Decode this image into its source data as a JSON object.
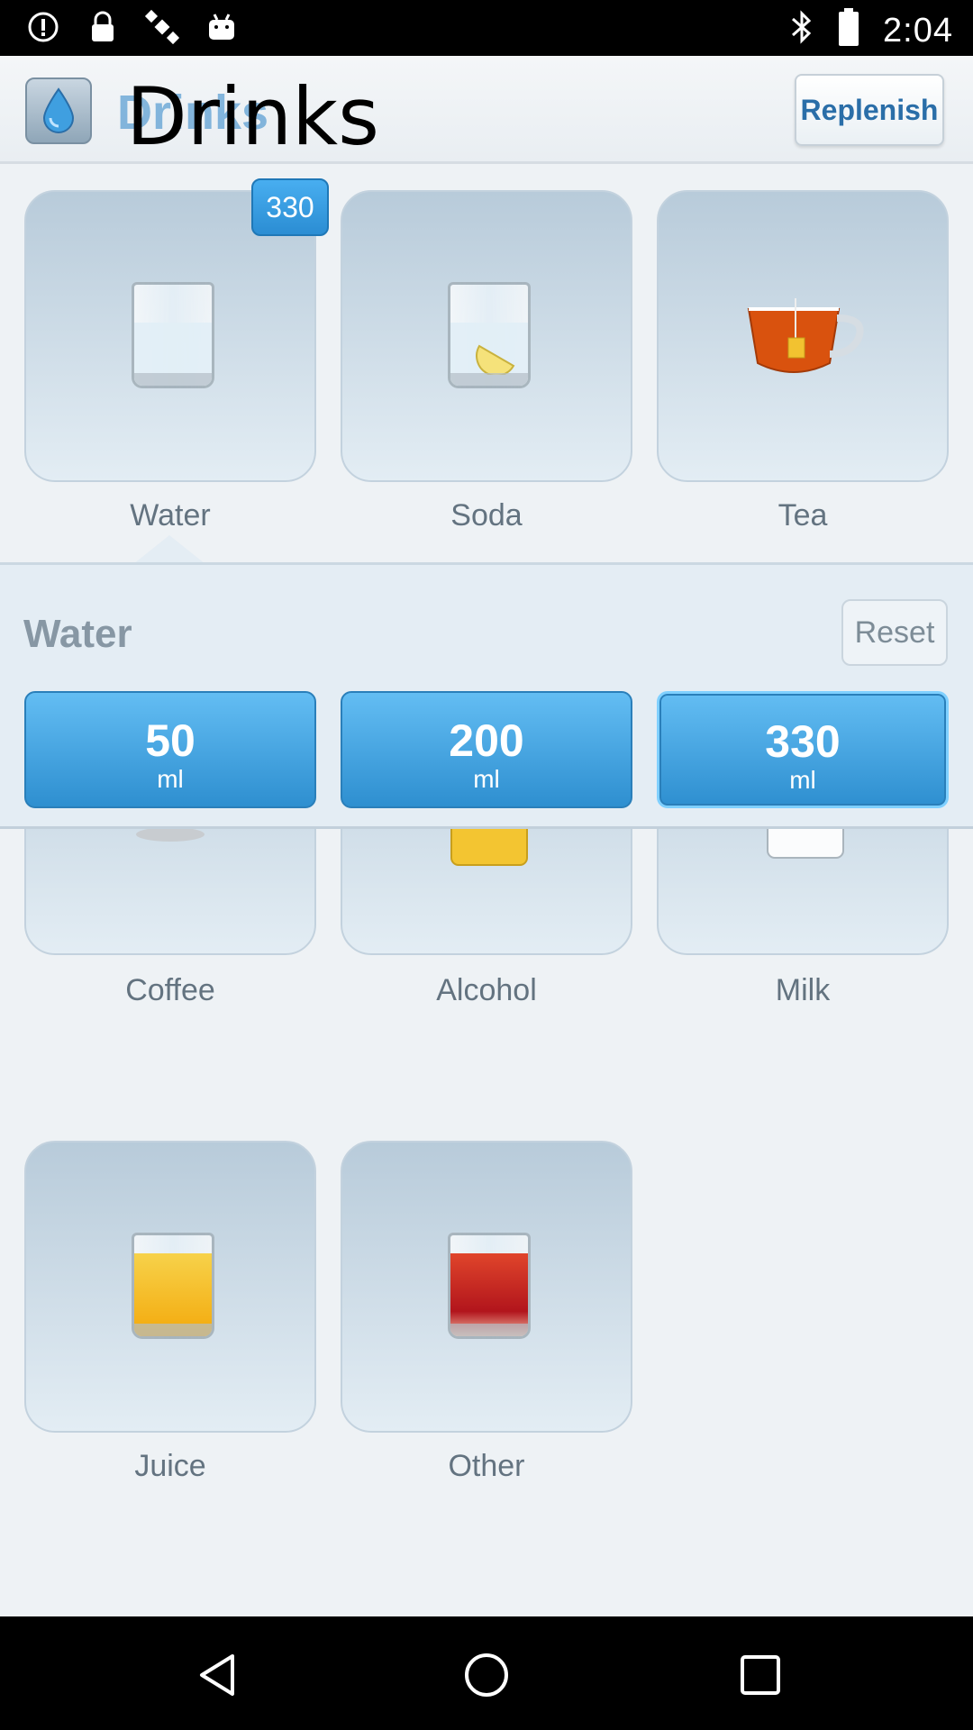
{
  "status_bar": {
    "time": "2:04",
    "icons": [
      "alert-icon",
      "lock-icon",
      "satellite-icon",
      "android-icon",
      "bluetooth-icon",
      "battery-icon"
    ]
  },
  "app_bar": {
    "title": "Drinks",
    "replenish_label": "Replenish"
  },
  "drinks": [
    {
      "label": "Water",
      "badge": "330",
      "icon": "water-glass-icon"
    },
    {
      "label": "Soda",
      "icon": "soda-glass-icon"
    },
    {
      "label": "Tea",
      "icon": "tea-cup-icon"
    },
    {
      "label": "Coffee",
      "icon": "coffee-cup-icon"
    },
    {
      "label": "Alcohol",
      "icon": "beer-glass-icon"
    },
    {
      "label": "Milk",
      "icon": "milk-glass-icon"
    },
    {
      "label": "Juice",
      "icon": "juice-glass-icon"
    },
    {
      "label": "Other",
      "icon": "other-glass-icon"
    }
  ],
  "panel": {
    "title": "Water",
    "reset_label": "Reset",
    "amounts": [
      {
        "value": "50",
        "unit": "ml"
      },
      {
        "value": "200",
        "unit": "ml"
      },
      {
        "value": "330",
        "unit": "ml",
        "selected": true
      }
    ]
  },
  "colors": {
    "accent": "#2e8fd0",
    "background": "#eef2f5"
  }
}
